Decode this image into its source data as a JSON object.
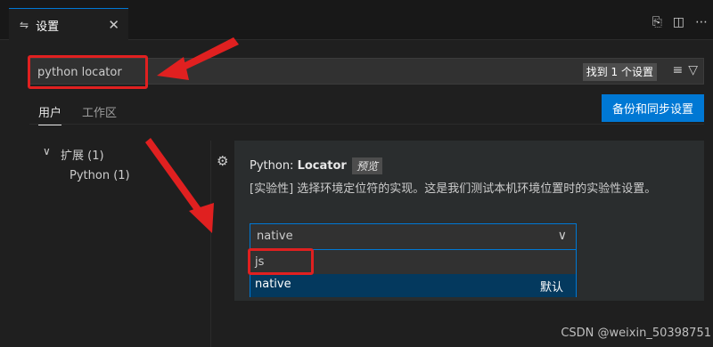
{
  "tab": {
    "label": "设置",
    "close": "✕"
  },
  "search": {
    "value": "python locator",
    "count": "找到 1 个设置"
  },
  "scope": {
    "user": "用户",
    "workspace": "工作区",
    "sync_button": "备份和同步设置"
  },
  "toc": {
    "extensions": "扩展 (1)",
    "python": "Python (1)"
  },
  "setting": {
    "prefix": "Python: ",
    "name": "Locator",
    "badge": "预览",
    "description": "[实验性] 选择环境定位符的实现。这是我们测试本机环境位置时的实验性设置。",
    "selected": "native",
    "options": [
      {
        "label": "js"
      },
      {
        "label": "native",
        "tag": "默认"
      }
    ]
  },
  "watermark": "CSDN @weixin_50398751",
  "colors": {
    "accent": "#0078d4",
    "annotation": "#e02020"
  }
}
